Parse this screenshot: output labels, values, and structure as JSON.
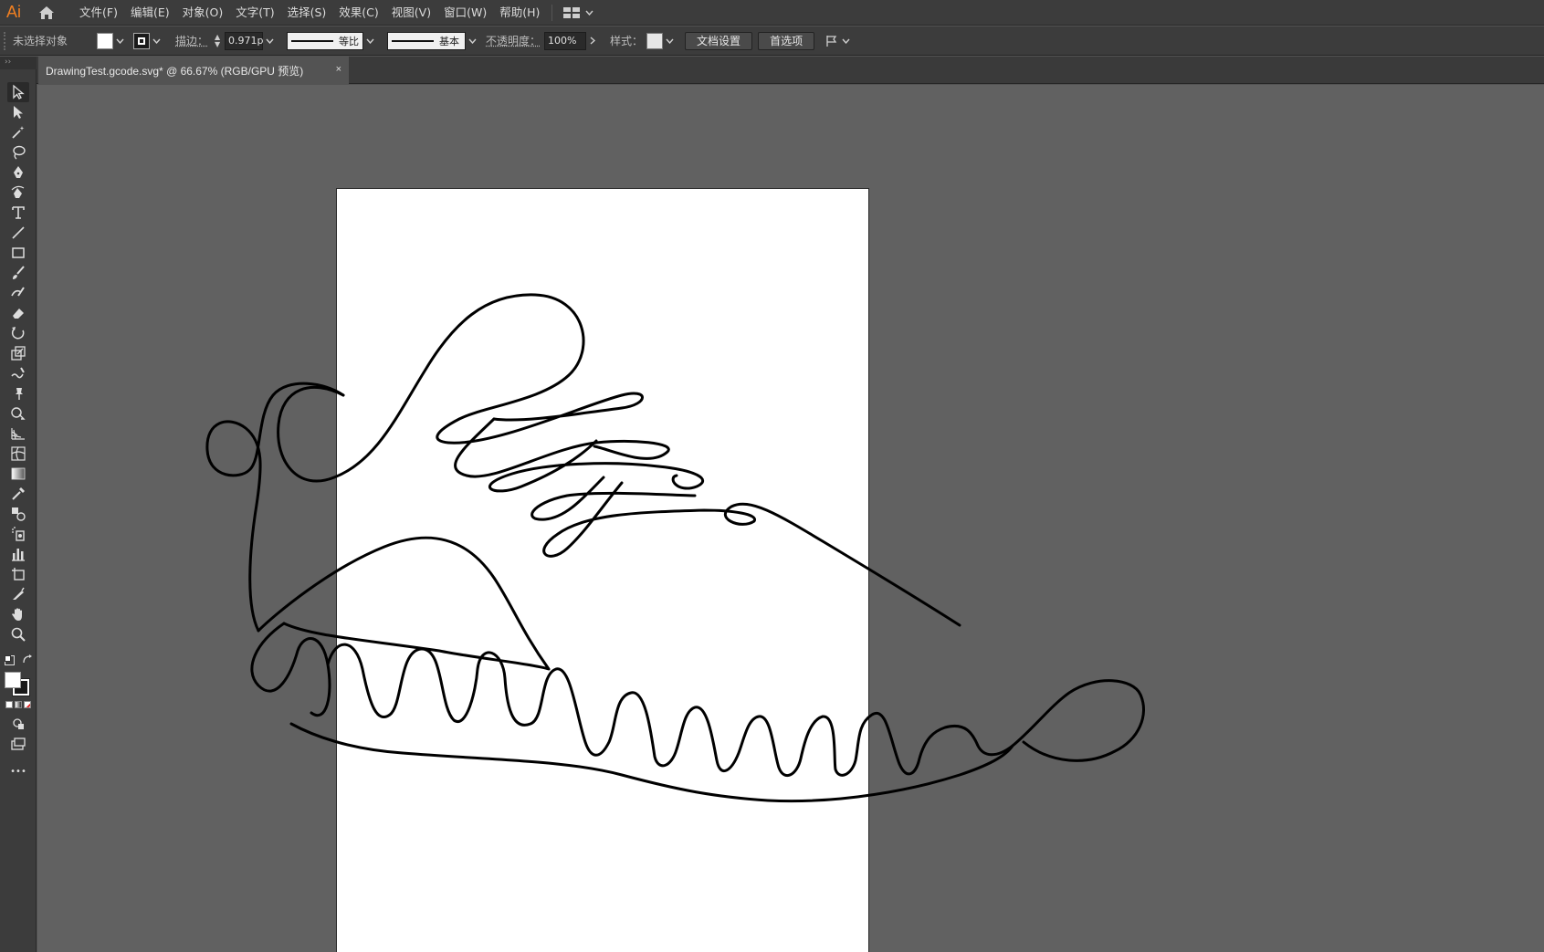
{
  "app": {
    "logo": "Ai"
  },
  "menu": {
    "items": [
      "文件(F)",
      "编辑(E)",
      "对象(O)",
      "文字(T)",
      "选择(S)",
      "效果(C)",
      "视图(V)",
      "窗口(W)",
      "帮助(H)"
    ]
  },
  "control": {
    "selection_label": "未选择对象",
    "stroke_label": "描边：",
    "stroke_value": "0.971",
    "stroke_unit": "p",
    "profile_label": "等比",
    "brush_label": "基本",
    "opacity_label": "不透明度：",
    "opacity_value": "100%",
    "style_label": "样式：",
    "doc_setup": "文档设置",
    "preferences": "首选项"
  },
  "document": {
    "tab_title": "DrawingTest.gcode.svg* @ 66.67% (RGB/GPU 预览)",
    "close_glyph": "×"
  },
  "toolbar": {
    "collapse_glyph": "››",
    "tools": [
      "selection-tool",
      "direct-selection-tool",
      "magic-wand-tool",
      "lasso-tool",
      "pen-tool",
      "curvature-tool",
      "type-tool",
      "line-tool",
      "rectangle-tool",
      "paintbrush-tool",
      "shaper-tool",
      "eraser-tool",
      "rotate-tool",
      "scale-tool",
      "warp-tool",
      "puppet-warp-tool",
      "shape-builder-tool",
      "perspective-grid-tool",
      "mesh-tool",
      "gradient-tool",
      "eyedropper-tool",
      "blend-tool",
      "symbol-sprayer-tool",
      "column-graph-tool",
      "artboard-tool",
      "slice-tool",
      "hand-tool",
      "zoom-tool"
    ],
    "more_glyph": "•••"
  },
  "colors": {
    "accent": "#f07f21",
    "canvas": "#616161",
    "artboard": "#ffffff",
    "chrome": "#3c3c3c"
  }
}
